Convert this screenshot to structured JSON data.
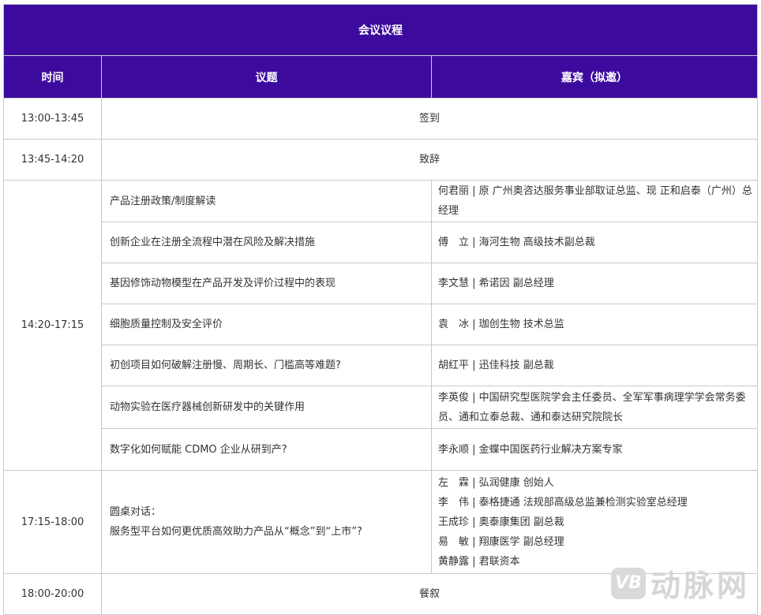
{
  "title": "会议议程",
  "headers": {
    "time": "时间",
    "topic": "议题",
    "guest": "嘉宾（拟邀）"
  },
  "rows": [
    {
      "time": "13:00-13:45",
      "merged": "签到"
    },
    {
      "time": "13:45-14:20",
      "merged": "致辞"
    },
    {
      "time": "14:20-17:15",
      "sessions": [
        {
          "topic": [
            "产品注册政策/制度解读"
          ],
          "guest": [
            "何君丽 | 原 广州奥咨达服务事业部取证总监、现 正和启泰（广州）总经理"
          ]
        },
        {
          "topic": [
            "创新企业在注册全流程中潜在风险及解决措施"
          ],
          "guest": [
            "傅　立 | 海河生物 高级技术副总裁"
          ]
        },
        {
          "topic": [
            "基因修饰动物模型在产品开发及评价过程中的表现"
          ],
          "guest": [
            "李文慧 | 希诺因 副总经理"
          ]
        },
        {
          "topic": [
            "细胞质量控制及安全评价"
          ],
          "guest": [
            "袁　冰 | 珈创生物 技术总监"
          ]
        },
        {
          "topic": [
            "初创项目如何破解注册慢、周期长、门槛高等难题?"
          ],
          "guest": [
            "胡红平 | 迅佳科技 副总裁"
          ]
        },
        {
          "topic": [
            "动物实验在医疗器械创新研发中的关键作用"
          ],
          "guest": [
            "李英俊 | 中国研究型医院学会主任委员、全军军事病理学学会常务委员、通和立泰总裁、通和泰达研究院院长"
          ]
        },
        {
          "topic": [
            "数字化如何赋能 CDMO 企业从研到产?"
          ],
          "guest": [
            "李永顺 | 金蝶中国医药行业解决方案专家"
          ]
        }
      ]
    },
    {
      "time": "17:15-18:00",
      "sessions": [
        {
          "topic": [
            "圆桌对话：",
            "服务型平台如何更优质高效助力产品从“概念”到“上市”?"
          ],
          "guest": [
            "左　霖 | 弘润健康 创始人",
            "李　伟 | 泰格捷通 法规部高级总监兼检测实验室总经理",
            "王成珍 | 奥泰康集团 副总裁",
            "易　敏 | 翔康医学 副总经理",
            "黄静露 | 君联资本"
          ]
        }
      ]
    },
    {
      "time": "18:00-20:00",
      "merged": "餐叙"
    }
  ],
  "watermark": {
    "logo": "VB",
    "text": "动脉网"
  },
  "colors": {
    "header_bg": "#3c0b9e",
    "header_text": "#ffffff",
    "border": "#c9c9c9"
  }
}
